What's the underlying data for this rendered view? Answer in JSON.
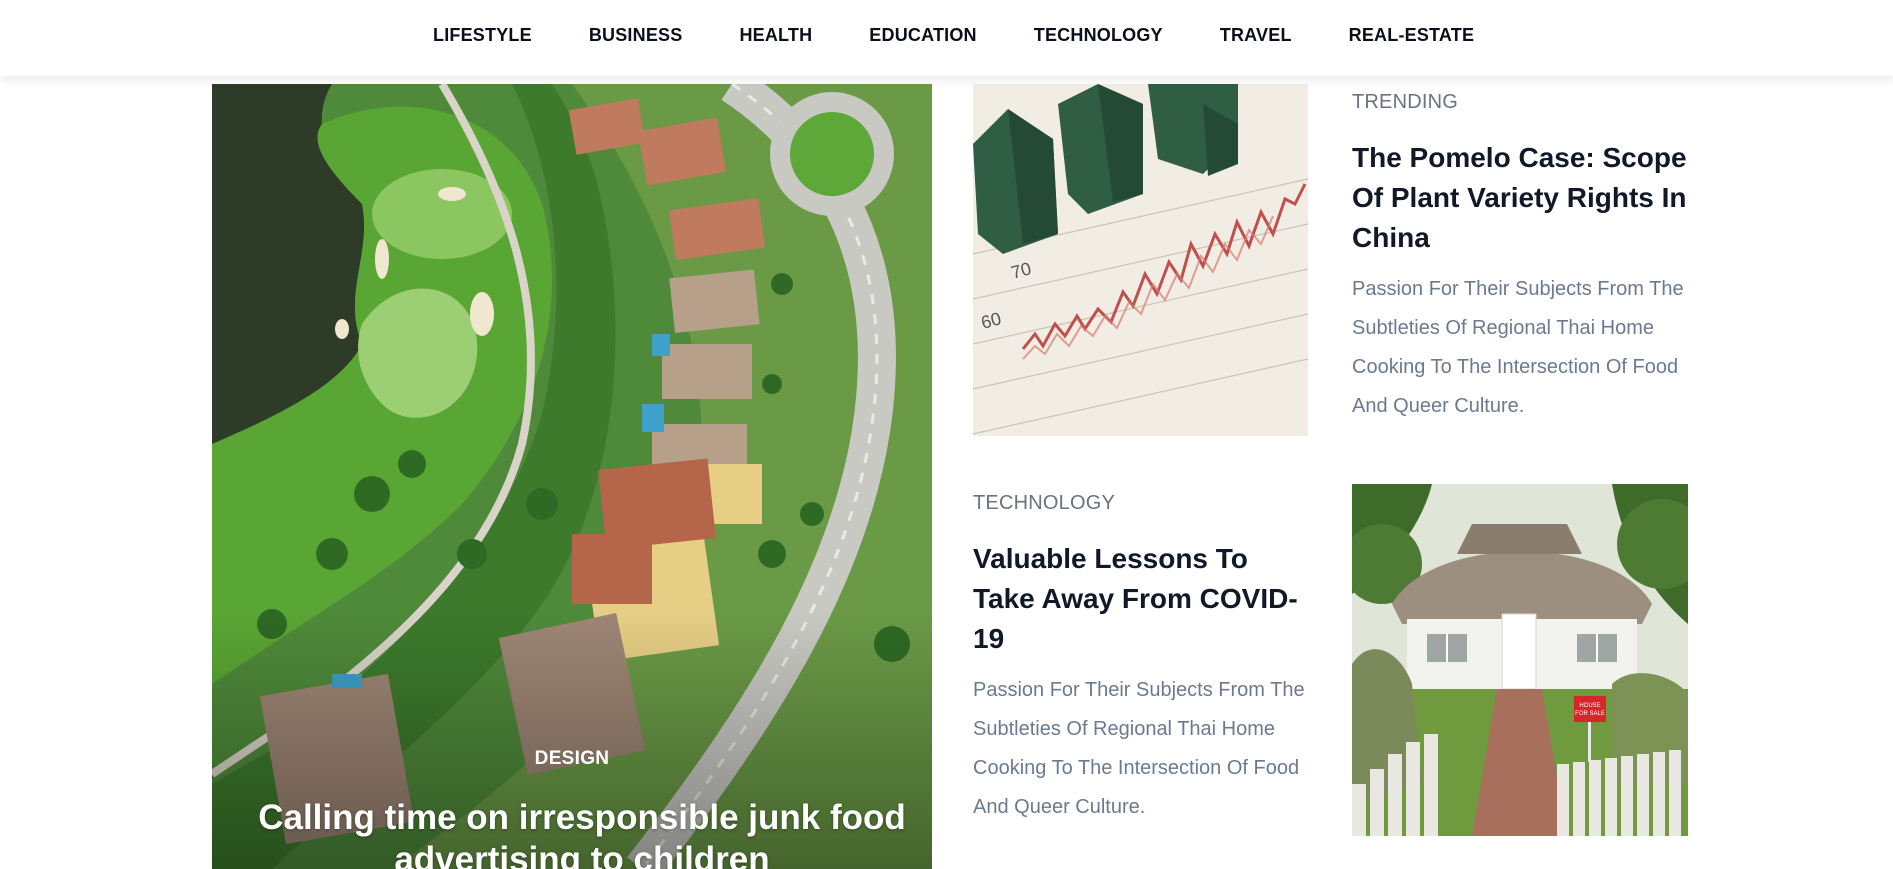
{
  "nav": {
    "items": [
      "LIFESTYLE",
      "BUSINESS",
      "HEALTH",
      "EDUCATION",
      "TECHNOLOGY",
      "TRAVEL",
      "REAL-ESTATE"
    ]
  },
  "hero": {
    "category": "DESIGN",
    "title": "Calling time on irresponsible junk food advertising to children"
  },
  "articles": [
    {
      "category": "TRENDING",
      "title": "The Pomelo Case: Scope Of Plant Variety Rights In China",
      "excerpt": "Passion For Their Subjects From The Subtleties Of Regional Thai Home Cooking To The Intersection Of Food And Queer Culture."
    },
    {
      "category": "TECHNOLOGY",
      "title": "Valuable Lessons To Take Away From COVID-19",
      "excerpt": "Passion For Their Subjects From The Subtleties Of Regional Thai Home Cooking To The Intersection Of Food And Queer Culture."
    }
  ],
  "images": {
    "chart_labels": [
      "70",
      "60"
    ],
    "sign_text": [
      "HOUSE",
      "FOR SALE"
    ]
  },
  "colors": {
    "nav_text": "#0b0f1a",
    "heading": "#111827",
    "category": "#6b7280",
    "excerpt": "#6b7a90",
    "golf_green": "#5aa634",
    "roof": "#b5654a"
  }
}
